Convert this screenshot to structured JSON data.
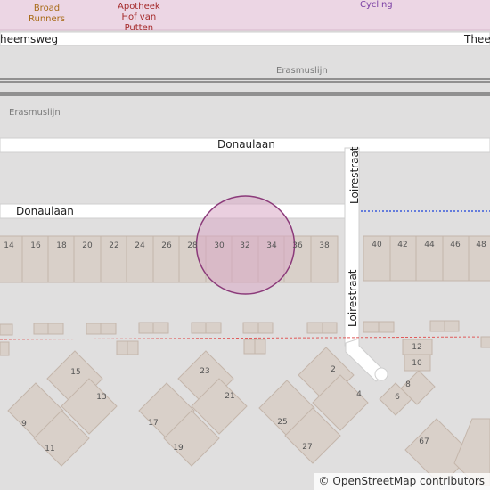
{
  "pois": {
    "broad_runners": "Broad\nRunners",
    "apotheek": "Apotheek\nHof van\nPutten",
    "cycling": "Cycling"
  },
  "streets": {
    "heemsweg_left": "heemsweg",
    "heemsweg_right": "Thee",
    "donaulaan_upper": "Donaulaan",
    "donaulaan_lower": "Donaulaan",
    "loirestraat_upper": "Loirestraat",
    "loirestraat_lower": "Loirestraat"
  },
  "railway": {
    "label_upper": "Erasmuslijn",
    "label_lower": "Erasmuslijn"
  },
  "house_numbers": {
    "row_left": [
      "14",
      "16",
      "18",
      "20",
      "22",
      "24",
      "26",
      "28",
      "30",
      "32",
      "34",
      "36",
      "38"
    ],
    "row_right": [
      "40",
      "42",
      "44",
      "46",
      "48"
    ],
    "south_left": [
      "15",
      "13",
      "9",
      "11"
    ],
    "south_mid": [
      "23",
      "21",
      "17",
      "19"
    ],
    "south_right": [
      "2",
      "4",
      "25",
      "27"
    ],
    "south_east": [
      "12",
      "10",
      "8",
      "6",
      "67"
    ]
  },
  "attribution": {
    "symbol": "©",
    "text": "OpenStreetMap contributors"
  },
  "colors": {
    "background": "#e0dfdf",
    "road": "#ffffff",
    "building": "#d9d0c9",
    "building_stroke": "#c4b6ab",
    "rail": "#777777",
    "marker_fill": "#d8a8c4",
    "marker_stroke": "#8b3a7a",
    "boundary_blue": "#3b5bdb",
    "boundary_red": "#e05a5a",
    "top_strip": "#ecd6e4"
  }
}
